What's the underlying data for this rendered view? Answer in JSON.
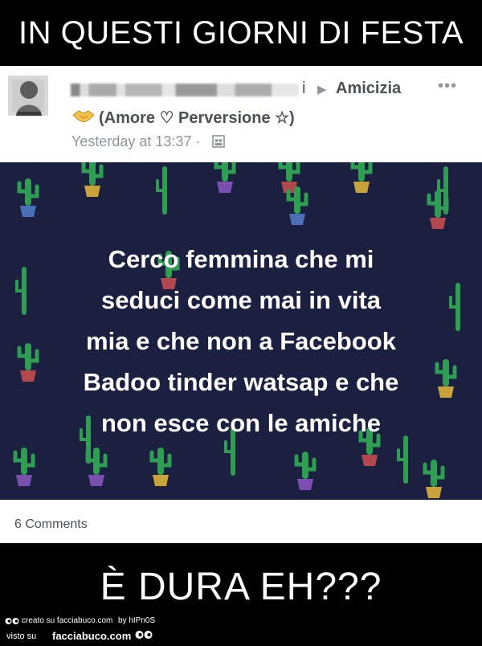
{
  "meme": {
    "top_caption": "IN QUESTI GIORNI DI FESTA",
    "bottom_caption": "È DURA EH???"
  },
  "post": {
    "author_tail": "i",
    "group_name": "Amicizia",
    "group_subtitle": "(Amore ♡ Perversione ☆)",
    "timestamp": "Yesterday at 13:37 ·",
    "more_label": "•••",
    "image_text_lines": [
      "Cerco femmina che mi",
      "seduci come mai in vita",
      "mia e che non a Facebook",
      "Badoo tinder watsap e che",
      "non esce con le amiche"
    ],
    "comments": "6 Comments"
  },
  "watermark": {
    "created_on": "creato su facciabuco.com",
    "by": "by hIPn0S",
    "seen_on": "visto su",
    "brand": "facciabuco.com"
  },
  "icons": {
    "more": "more-options-icon",
    "arrow": "arrow-right-icon",
    "handshake": "handshake-icon",
    "group": "group-audience-icon",
    "eyes": "eyes-logo-icon"
  },
  "colors": {
    "meme_background": "#000000",
    "post_background": "#ffffff",
    "image_background": "#1c2040",
    "cactus_green": "#2f9e52",
    "text_gray": "#4b4f56",
    "meta_gray": "#90949c"
  }
}
